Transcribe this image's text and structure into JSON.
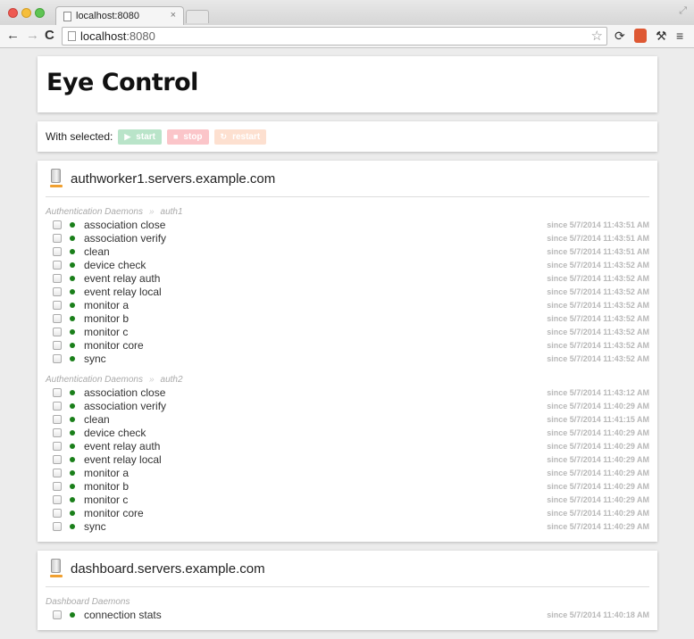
{
  "browser": {
    "tab_title": "localhost:8080",
    "tab_close": "×",
    "url_host": "localhost",
    "url_port": ":8080",
    "icons": {
      "back": "←",
      "forward": "→",
      "reload": "C",
      "star": "☆",
      "sync": "⟳",
      "wrench": "⚒",
      "menu": "≡",
      "resize": "⤢"
    }
  },
  "app": {
    "title": "Eye Control"
  },
  "actions": {
    "label": "With selected:",
    "buttons": [
      {
        "label": "start",
        "glyph": "▶",
        "color": "#b9e4c9"
      },
      {
        "label": "stop",
        "glyph": "■",
        "color": "#fbc5c9"
      },
      {
        "label": "restart",
        "glyph": "↻",
        "color": "#fde0d0"
      }
    ]
  },
  "status_color": "#1a7f1a",
  "servers": [
    {
      "name": "authworker1.servers.example.com",
      "groups": [
        {
          "category": "Authentication Daemons",
          "separator": "»",
          "sub": "auth1",
          "daemons": [
            {
              "name": "association close",
              "since": "since 5/7/2014 11:43:51 AM"
            },
            {
              "name": "association verify",
              "since": "since 5/7/2014 11:43:51 AM"
            },
            {
              "name": "clean",
              "since": "since 5/7/2014 11:43:51 AM"
            },
            {
              "name": "device check",
              "since": "since 5/7/2014 11:43:52 AM"
            },
            {
              "name": "event relay auth",
              "since": "since 5/7/2014 11:43:52 AM"
            },
            {
              "name": "event relay local",
              "since": "since 5/7/2014 11:43:52 AM"
            },
            {
              "name": "monitor a",
              "since": "since 5/7/2014 11:43:52 AM"
            },
            {
              "name": "monitor b",
              "since": "since 5/7/2014 11:43:52 AM"
            },
            {
              "name": "monitor c",
              "since": "since 5/7/2014 11:43:52 AM"
            },
            {
              "name": "monitor core",
              "since": "since 5/7/2014 11:43:52 AM"
            },
            {
              "name": "sync",
              "since": "since 5/7/2014 11:43:52 AM"
            }
          ]
        },
        {
          "category": "Authentication Daemons",
          "separator": "»",
          "sub": "auth2",
          "daemons": [
            {
              "name": "association close",
              "since": "since 5/7/2014 11:43:12 AM"
            },
            {
              "name": "association verify",
              "since": "since 5/7/2014 11:40:29 AM"
            },
            {
              "name": "clean",
              "since": "since 5/7/2014 11:41:15 AM"
            },
            {
              "name": "device check",
              "since": "since 5/7/2014 11:40:29 AM"
            },
            {
              "name": "event relay auth",
              "since": "since 5/7/2014 11:40:29 AM"
            },
            {
              "name": "event relay local",
              "since": "since 5/7/2014 11:40:29 AM"
            },
            {
              "name": "monitor a",
              "since": "since 5/7/2014 11:40:29 AM"
            },
            {
              "name": "monitor b",
              "since": "since 5/7/2014 11:40:29 AM"
            },
            {
              "name": "monitor c",
              "since": "since 5/7/2014 11:40:29 AM"
            },
            {
              "name": "monitor core",
              "since": "since 5/7/2014 11:40:29 AM"
            },
            {
              "name": "sync",
              "since": "since 5/7/2014 11:40:29 AM"
            }
          ]
        }
      ]
    },
    {
      "name": "dashboard.servers.example.com",
      "groups": [
        {
          "category": "Dashboard Daemons",
          "separator": "",
          "sub": "",
          "daemons": [
            {
              "name": "connection stats",
              "since": "since 5/7/2014 11:40:18 AM"
            }
          ]
        }
      ]
    }
  ]
}
